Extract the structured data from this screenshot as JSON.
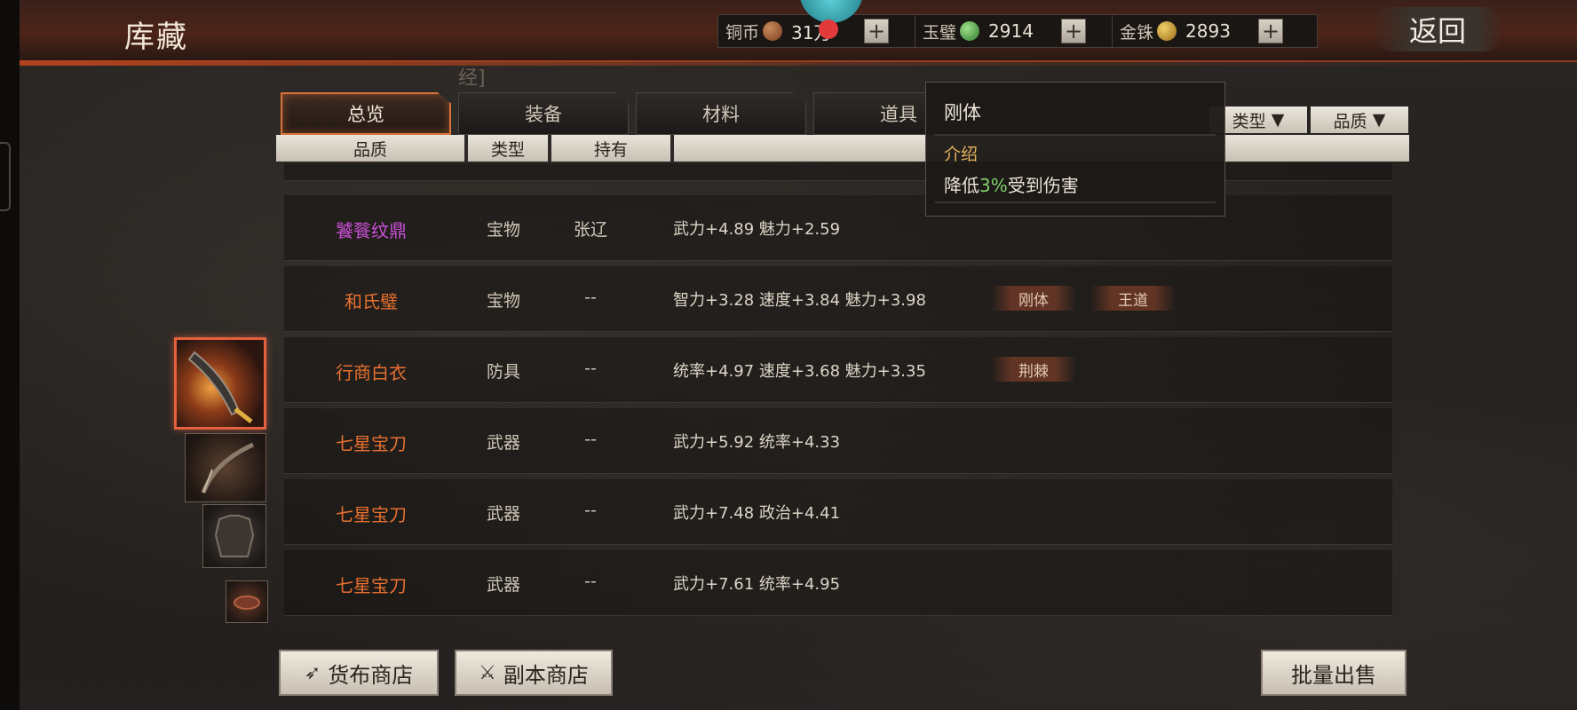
{
  "header": {
    "title": "库藏",
    "back_label": "返回"
  },
  "currencies": [
    {
      "label": "铜币",
      "value": "31万",
      "icon": "copper-coin-icon"
    },
    {
      "label": "玉璧",
      "value": "2914",
      "icon": "jade-disc-icon"
    },
    {
      "label": "金铢",
      "value": "2893",
      "icon": "gold-coin-icon"
    }
  ],
  "plus_label": "+",
  "faded_text": "经]",
  "tabs": [
    {
      "label": "总览",
      "active": true
    },
    {
      "label": "装备",
      "active": false
    },
    {
      "label": "材料",
      "active": false
    },
    {
      "label": "道具",
      "active": false
    }
  ],
  "filters": {
    "type_label": "类型",
    "quality_label": "品质",
    "arrow": "▼"
  },
  "columns": {
    "quality": "品质",
    "type": "类型",
    "holder": "持有"
  },
  "rows": [
    {
      "name": "饕餮纹鼎",
      "type": "宝物",
      "holder": "张辽",
      "stats": "武力+4.89  魅力+2.59",
      "traits": [],
      "quality": "purple"
    },
    {
      "name": "和氏璧",
      "type": "宝物",
      "holder": "--",
      "stats": "智力+3.28  速度+3.84  魅力+3.98",
      "traits": [
        "刚体",
        "王道"
      ],
      "quality": "orange"
    },
    {
      "name": "行商白衣",
      "type": "防具",
      "holder": "--",
      "stats": "统率+4.97  速度+3.68  魅力+3.35",
      "traits": [
        "荆棘"
      ],
      "quality": "orange"
    },
    {
      "name": "七星宝刀",
      "type": "武器",
      "holder": "--",
      "stats": "武力+5.92  统率+4.33",
      "traits": [],
      "quality": "orange"
    },
    {
      "name": "七星宝刀",
      "type": "武器",
      "holder": "--",
      "stats": "武力+7.48  政治+4.41",
      "traits": [],
      "quality": "orange"
    },
    {
      "name": "七星宝刀",
      "type": "武器",
      "holder": "--",
      "stats": "武力+7.61  统率+4.95",
      "traits": [],
      "quality": "orange"
    }
  ],
  "tooltip": {
    "title": "刚体",
    "section": "介绍",
    "body_prefix": "降低",
    "body_value": "3%",
    "body_suffix": "受到伤害"
  },
  "thumbnails": [
    {
      "icon": "blade-weapon-icon",
      "selected": true
    },
    {
      "icon": "bow-weapon-icon",
      "selected": false
    },
    {
      "icon": "armor-icon",
      "selected": false
    },
    {
      "icon": "small-item-icon",
      "selected": false
    }
  ],
  "bottom_buttons": {
    "currency_shop": "货布商店",
    "dungeon_shop": "副本商店",
    "bulk_sell": "批量出售"
  },
  "colors": {
    "quality_purple": "#c84fd6",
    "quality_orange": "#e8702f",
    "accent": "#d8733a",
    "highlight_green": "#7fd36a"
  }
}
